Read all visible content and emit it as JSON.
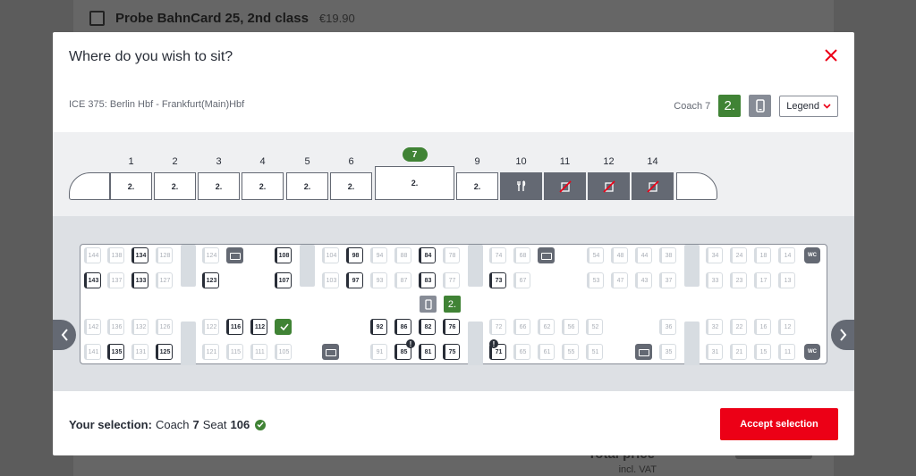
{
  "background": {
    "option_title": "Probe BahnCard 25, 2nd class",
    "option_price": "€19.90",
    "total_label": "Total price",
    "total_sub": "incl. VAT"
  },
  "modal": {
    "title": "Where do you wish to sit?",
    "route": "ICE 375: Berlin Hbf - Frankfurt(Main)Hbf",
    "coach_label": "Coach 7",
    "class_badge": "2.",
    "legend_label": "Legend"
  },
  "train": {
    "active_coach": "7",
    "coaches": [
      {
        "num": "1",
        "label": "2.",
        "kind": "class"
      },
      {
        "num": "2",
        "label": "2.",
        "kind": "class"
      },
      {
        "num": "3",
        "label": "2.",
        "kind": "class"
      },
      {
        "num": "4",
        "label": "2.",
        "kind": "class"
      },
      {
        "num": "5",
        "label": "2.",
        "kind": "class"
      },
      {
        "num": "6",
        "label": "2.",
        "kind": "class"
      },
      {
        "num": "7",
        "label": "2.",
        "kind": "active"
      },
      {
        "num": "9",
        "label": "2.",
        "kind": "class"
      },
      {
        "num": "10",
        "label": "",
        "kind": "restaurant"
      },
      {
        "num": "11",
        "label": "",
        "kind": "1st"
      },
      {
        "num": "12",
        "label": "",
        "kind": "1st"
      },
      {
        "num": "14",
        "label": "",
        "kind": "1st"
      }
    ]
  },
  "seatmap": {
    "row1": [
      "144",
      "138",
      "134",
      "128",
      "124",
      "108",
      "104",
      "98",
      "94",
      "88",
      "84",
      "78",
      "74",
      "68",
      "54",
      "48",
      "44",
      "38",
      "34",
      "24",
      "18",
      "14"
    ],
    "row2": [
      "143",
      "137",
      "133",
      "127",
      "123",
      "107",
      "103",
      "97",
      "93",
      "87",
      "83",
      "77",
      "73",
      "67",
      "53",
      "47",
      "43",
      "37",
      "33",
      "23",
      "17",
      "13"
    ],
    "row3": [
      "142",
      "136",
      "132",
      "126",
      "122",
      "116",
      "112",
      "92",
      "86",
      "82",
      "76",
      "72",
      "66",
      "62",
      "56",
      "52",
      "36",
      "32",
      "22",
      "16",
      "12"
    ],
    "row4": [
      "141",
      "135",
      "131",
      "125",
      "121",
      "115",
      "111",
      "105",
      "91",
      "85",
      "81",
      "75",
      "71",
      "65",
      "61",
      "55",
      "51",
      "35",
      "31",
      "21",
      "15",
      "11"
    ],
    "free": [
      "134",
      "143",
      "133",
      "108",
      "107",
      "123",
      "98",
      "97",
      "84",
      "83",
      "73",
      "116",
      "112",
      "92",
      "86",
      "82",
      "76",
      "135",
      "125",
      "85",
      "81",
      "75",
      "71"
    ],
    "selected_seat": "106",
    "wc_label": "WC",
    "map_class": "2."
  },
  "footer": {
    "selection_prefix": "Your selection:",
    "coach_word": "Coach",
    "coach_value": "7",
    "seat_word": "Seat",
    "seat_value": "106",
    "accept_label": "Accept selection"
  },
  "colors": {
    "accent_red": "#ec0016",
    "class_green": "#408335",
    "seat_grey": "#646973"
  }
}
